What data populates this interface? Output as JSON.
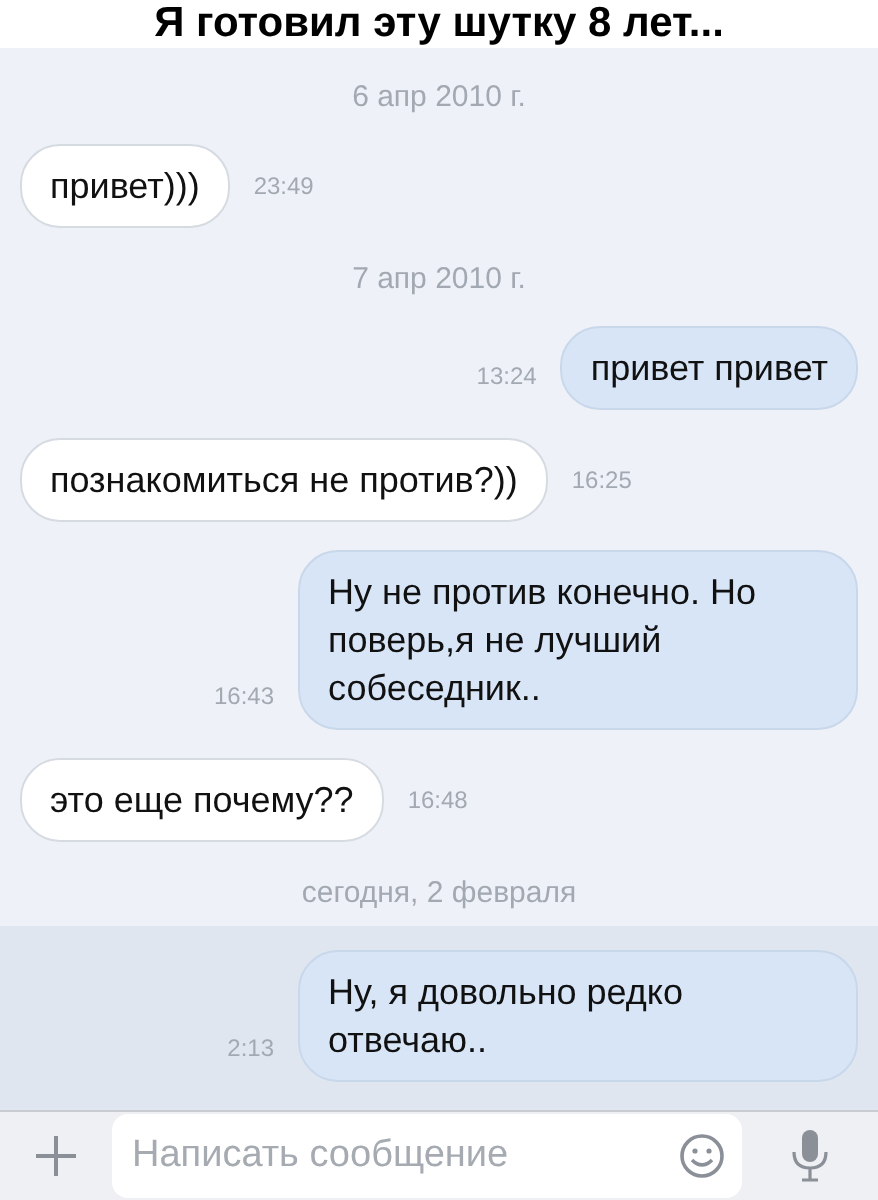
{
  "caption": "Я готовил эту шутку 8 лет...",
  "chat": [
    {
      "kind": "date",
      "text": "6 апр 2010 г."
    },
    {
      "kind": "message",
      "outgoing": false,
      "highlighted": false,
      "text": "привет)))",
      "time": "23:49"
    },
    {
      "kind": "date",
      "text": "7 апр 2010 г."
    },
    {
      "kind": "message",
      "outgoing": true,
      "highlighted": false,
      "text": "привет привет",
      "time": "13:24"
    },
    {
      "kind": "message",
      "outgoing": false,
      "highlighted": false,
      "text": "познакомиться не против?))",
      "time": "16:25"
    },
    {
      "kind": "message",
      "outgoing": true,
      "highlighted": false,
      "text": "Ну не против конечно. Но поверь,я не лучший собеседник..",
      "time": "16:43"
    },
    {
      "kind": "message",
      "outgoing": false,
      "highlighted": false,
      "text": "это еще почему??",
      "time": "16:48"
    },
    {
      "kind": "date",
      "text": "сегодня, 2 февраля"
    },
    {
      "kind": "message",
      "outgoing": true,
      "highlighted": true,
      "text": "Ну, я довольно редко отвечаю..",
      "time": "2:13"
    }
  ],
  "composer": {
    "placeholder": "Написать сообщение"
  }
}
